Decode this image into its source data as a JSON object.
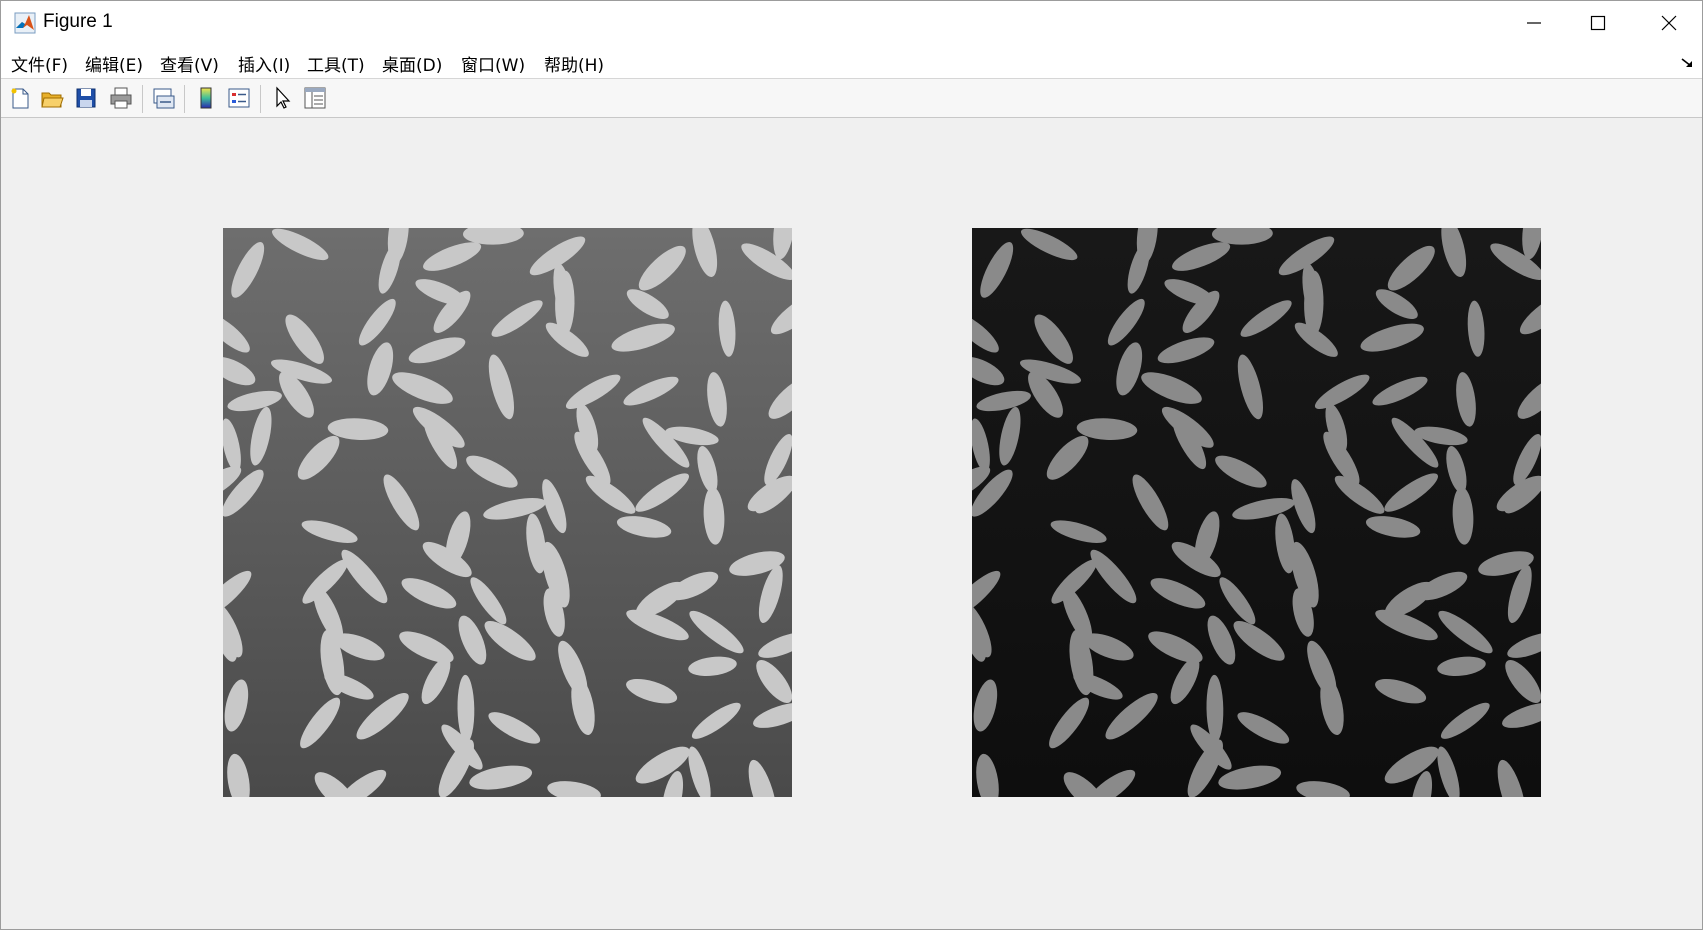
{
  "window": {
    "title": "Figure 1",
    "controls": {
      "minimize": "minimize-icon",
      "maximize": "maximize-icon",
      "close": "close-icon"
    }
  },
  "menubar": {
    "items": [
      {
        "label": "文件(F)"
      },
      {
        "label": "编辑(E)"
      },
      {
        "label": "查看(V)"
      },
      {
        "label": "插入(I)"
      },
      {
        "label": "工具(T)"
      },
      {
        "label": "桌面(D)"
      },
      {
        "label": "窗口(W)"
      },
      {
        "label": "帮助(H)"
      }
    ]
  },
  "toolbar": {
    "buttons": [
      {
        "name": "new-figure-icon"
      },
      {
        "name": "open-file-icon"
      },
      {
        "name": "save-icon"
      },
      {
        "name": "print-icon"
      },
      {
        "name": "link-plot-icon"
      },
      {
        "name": "insert-colorbar-icon"
      },
      {
        "name": "insert-legend-icon"
      },
      {
        "name": "edit-plot-pointer-icon"
      },
      {
        "name": "property-inspector-icon"
      }
    ]
  },
  "figure": {
    "panels": [
      {
        "name": "original-rice-image",
        "background": "#5d5d5d",
        "grain": "#c8c8c8"
      },
      {
        "name": "processed-rice-image",
        "background": "#131313",
        "grain": "#8a8a8a"
      }
    ]
  },
  "colors": {
    "titlebar_bg": "#ffffff",
    "figure_bg": "#f0f0f0",
    "matlab_orange": "#d95319",
    "matlab_blue": "#0072bd"
  }
}
